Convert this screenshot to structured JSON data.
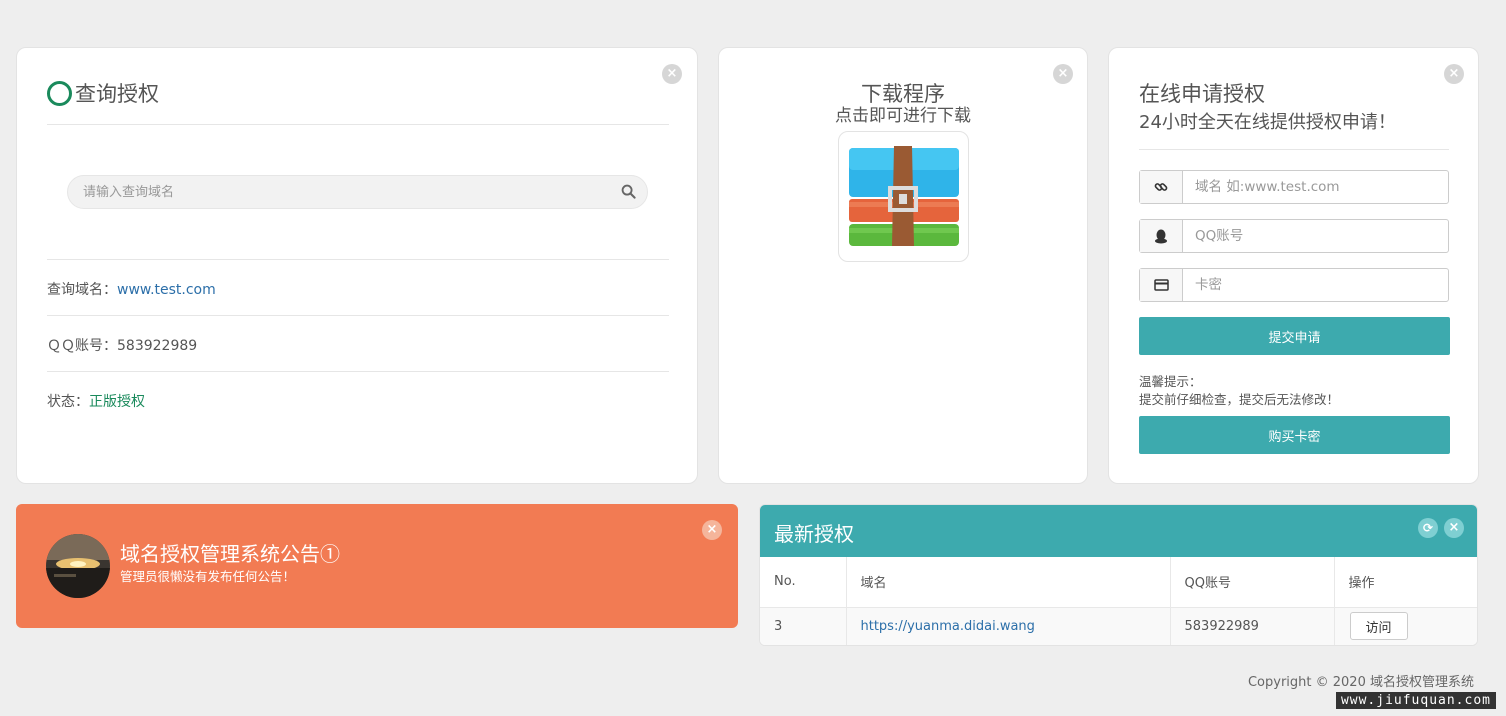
{
  "query_card": {
    "title": "查询授权",
    "search_placeholder": "请输入查询域名",
    "domain_label": "查询域名：",
    "domain_value": "www.test.com",
    "qq_label": "ＱＱ账号：",
    "qq_value": "583922989",
    "status_label": "状态：",
    "status_value": "正版授权"
  },
  "download_card": {
    "title": "下载程序",
    "subtitle": "点击即可进行下载"
  },
  "apply_card": {
    "title": "在线申请授权",
    "subtitle": "24小时全天在线提供授权申请！",
    "domain_placeholder": "域名 如:www.test.com",
    "qq_placeholder": "QQ账号",
    "card_placeholder": "卡密",
    "submit_label": "提交申请",
    "tip_title": "温馨提示：",
    "tip_text": "提交前仔细检查，提交后无法修改！",
    "buy_label": "购买卡密"
  },
  "notice": {
    "title": "域名授权管理系统公告①",
    "text": "管理员很懒没有发布任何公告！"
  },
  "latest": {
    "title": "最新授权",
    "columns": [
      "No.",
      "域名",
      "QQ账号",
      "操作"
    ],
    "rows": [
      {
        "no": "3",
        "domain": "https://yuanma.didai.wang",
        "qq": "583922989",
        "action": "访问"
      }
    ]
  },
  "footer": {
    "copyright": "Copyright © 2020 域名授权管理系统",
    "watermark": "www.jiufuquan.com"
  },
  "colors": {
    "teal": "#3daaae",
    "orange": "#f27b53",
    "green": "#1a8a5c",
    "link": "#2c6fa9"
  }
}
